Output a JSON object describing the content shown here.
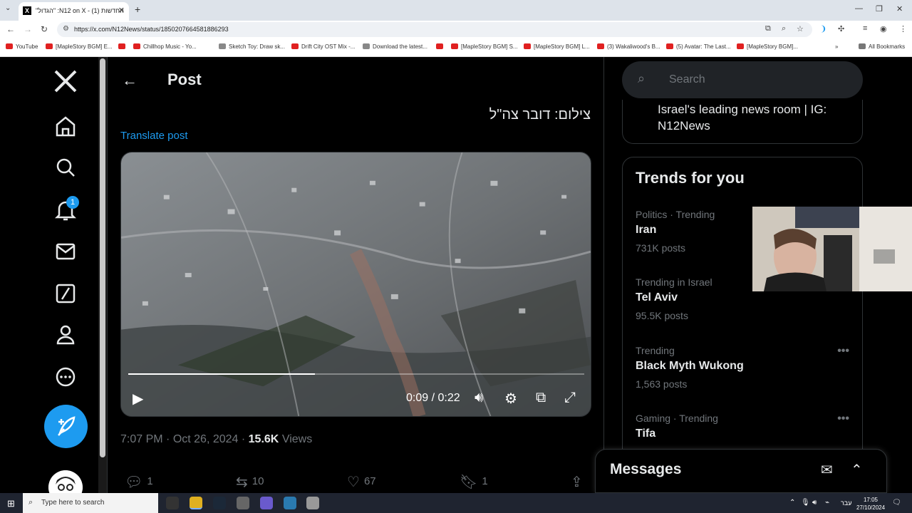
{
  "browser": {
    "tab_title": "\"הגדול\" :N12 on X - החדשות (1)",
    "url": "https://x.com/N12News/status/1850207664581886293",
    "bookmarks": [
      {
        "label": "YouTube",
        "kind": "yt"
      },
      {
        "label": "[MapleStory BGM] E...",
        "kind": "yt"
      },
      {
        "label": "",
        "kind": "yt"
      },
      {
        "label": "Chillhop Music - Yo...",
        "kind": "yt"
      },
      {
        "label": "Sketch Toy: Draw sk...",
        "kind": "ic"
      },
      {
        "label": "Drift City OST Mix -...",
        "kind": "yt"
      },
      {
        "label": "Download the latest...",
        "kind": "ic"
      },
      {
        "label": "",
        "kind": "yt"
      },
      {
        "label": "[MapleStory BGM] S...",
        "kind": "yt"
      },
      {
        "label": "[MapleStory BGM] L...",
        "kind": "yt"
      },
      {
        "label": "(3) Wakaliwood's B...",
        "kind": "yt"
      },
      {
        "label": "(5) Avatar: The Last...",
        "kind": "yt"
      },
      {
        "label": "[MapleStory BGM]...",
        "kind": "yt"
      }
    ],
    "all_bookmarks": "All Bookmarks"
  },
  "nav": {
    "notifications_badge": "1"
  },
  "post": {
    "heading": "Post",
    "text": "צילום: דובר צה\"ל",
    "translate": "Translate post",
    "video": {
      "current": "0:09",
      "separator": "/",
      "duration": "0:22",
      "progress": 0.41
    },
    "time": "7:07 PM",
    "date": "Oct 26, 2024",
    "views_count": "15.6K",
    "views_label": "Views",
    "replies": "1",
    "reposts": "10",
    "likes": "67",
    "bookmarks": "1"
  },
  "sidebar": {
    "search_placeholder": "Search",
    "bio": "Israel's leading news room | IG: N12News",
    "trends_title": "Trends for you",
    "trends": [
      {
        "context": "Politics · Trending",
        "name": "Iran",
        "posts": "731K posts"
      },
      {
        "context": "Trending in Israel",
        "name": "Tel Aviv",
        "posts": "95.5K posts"
      },
      {
        "context": "Trending",
        "name": "Black Myth Wukong",
        "posts": "1,563 posts"
      },
      {
        "context": "Gaming · Trending",
        "name": "Tifa",
        "posts": ""
      }
    ],
    "messages_title": "Messages"
  },
  "taskbar": {
    "search_placeholder": "Type here to search",
    "lang": "עבר",
    "time": "17:05",
    "date": "27/10/2024"
  },
  "colors": {
    "accent": "#1d9bf0",
    "background": "#000000",
    "muted": "#71767b"
  }
}
